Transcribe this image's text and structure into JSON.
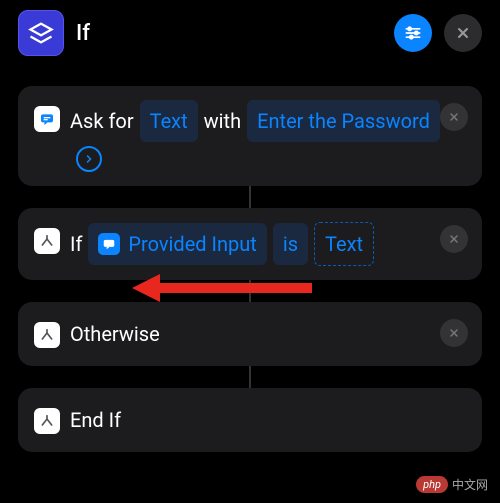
{
  "header": {
    "title": "If"
  },
  "blocks": {
    "ask": {
      "prefix": "Ask for",
      "type_pill": "Text",
      "with": "with",
      "prompt_pill": "Enter the Password"
    },
    "if": {
      "label": "If",
      "input_pill": "Provided Input",
      "op": "is",
      "value_pill": "Text"
    },
    "otherwise": {
      "label": "Otherwise"
    },
    "endif": {
      "label": "End If"
    }
  },
  "watermark": {
    "badge": "php",
    "text": "中文网"
  }
}
